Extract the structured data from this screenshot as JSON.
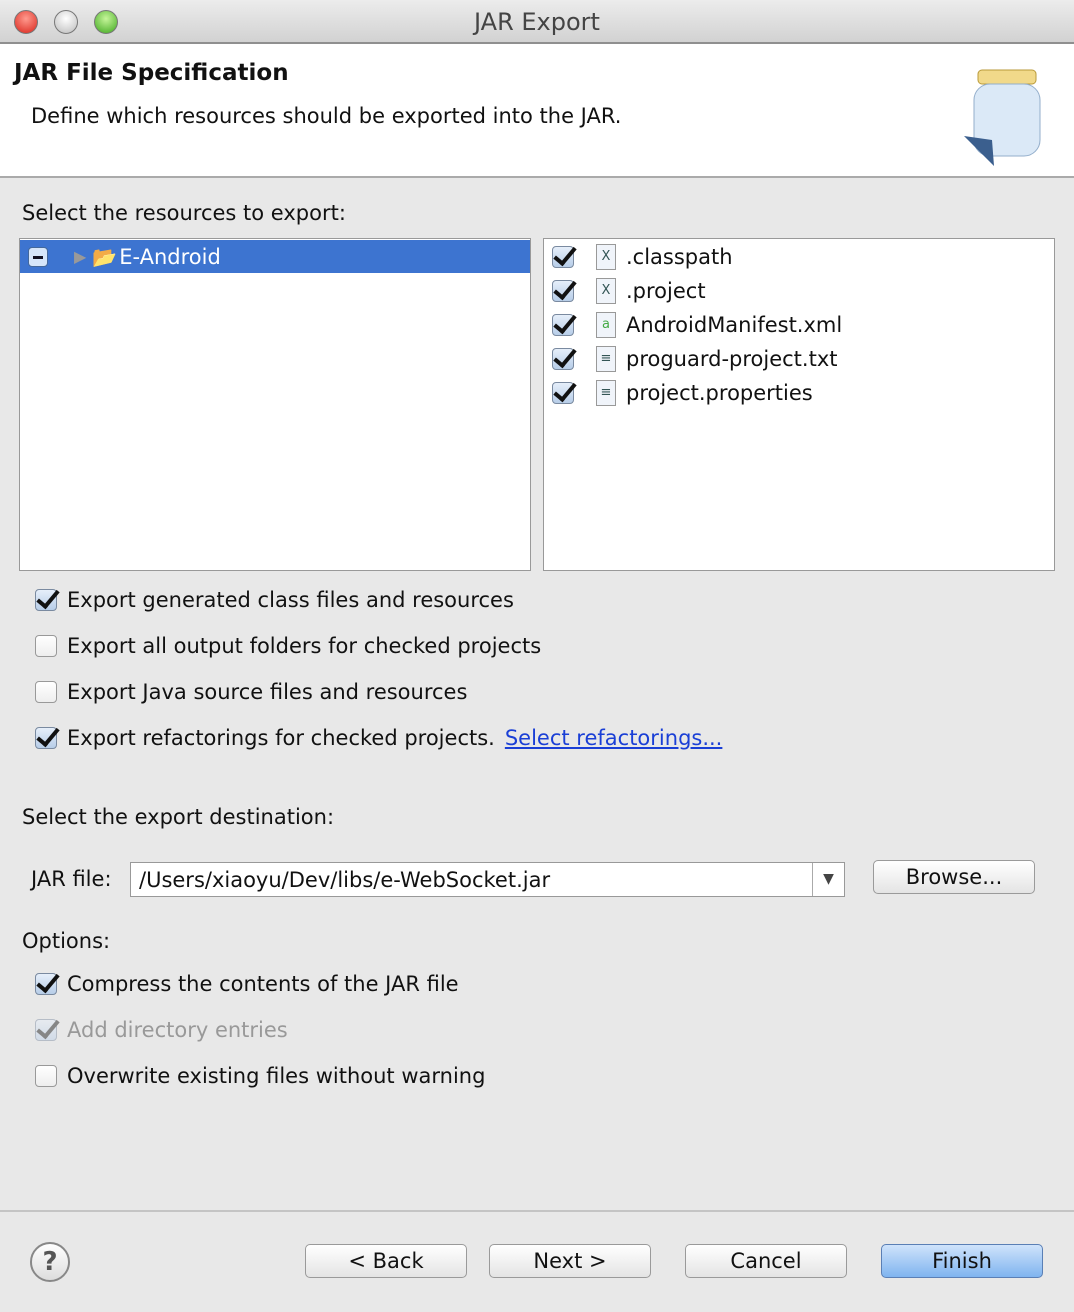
{
  "window": {
    "title": "JAR Export"
  },
  "header": {
    "title": "JAR File Specification",
    "description": "Define which resources should be exported into the JAR."
  },
  "resources": {
    "label": "Select the resources to export:",
    "tree": [
      {
        "label": "E-Android",
        "selected": true,
        "checked": "partial"
      }
    ],
    "files": [
      {
        "name": ".classpath",
        "icon": "xml-x-file-icon",
        "checked": true
      },
      {
        "name": ".project",
        "icon": "xml-x-file-icon",
        "checked": true
      },
      {
        "name": "AndroidManifest.xml",
        "icon": "android-manifest-icon",
        "checked": true
      },
      {
        "name": "proguard-project.txt",
        "icon": "text-file-icon",
        "checked": true
      },
      {
        "name": "project.properties",
        "icon": "text-file-icon",
        "checked": true
      }
    ]
  },
  "export_options": [
    {
      "label": "Export generated class files and resources",
      "checked": true
    },
    {
      "label": "Export all output folders for checked projects",
      "checked": false
    },
    {
      "label": "Export Java source files and resources",
      "checked": false
    },
    {
      "label": "Export refactorings for checked projects.",
      "checked": true,
      "link": "Select refactorings..."
    }
  ],
  "destination": {
    "label": "Select the export destination:",
    "jar_label": "JAR file:",
    "jar_value": "/Users/xiaoyu/Dev/libs/e-WebSocket.jar",
    "browse": "Browse..."
  },
  "options": {
    "label": "Options:",
    "items": [
      {
        "label": "Compress the contents of the JAR file",
        "checked": true,
        "enabled": true
      },
      {
        "label": "Add directory entries",
        "checked": true,
        "enabled": false
      },
      {
        "label": "Overwrite existing files without warning",
        "checked": false,
        "enabled": true
      }
    ]
  },
  "footer": {
    "back": "< Back",
    "next": "Next >",
    "cancel": "Cancel",
    "finish": "Finish"
  }
}
